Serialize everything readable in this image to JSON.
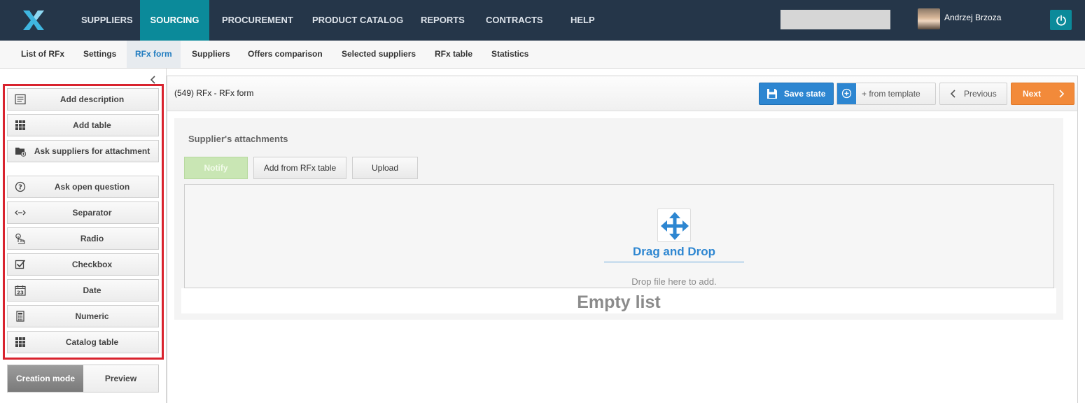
{
  "topnav": {
    "items": [
      "SUPPLIERS",
      "SOURCING",
      "PROCUREMENT",
      "PRODUCT CATALOG",
      "REPORTS",
      "CONTRACTS",
      "HELP"
    ],
    "active": "SOURCING"
  },
  "user": {
    "name": "Andrzej Brzoza"
  },
  "subnav": {
    "items": [
      "List of RFx",
      "Settings",
      "RFx form",
      "Suppliers",
      "Offers comparison",
      "Selected suppliers",
      "RFx table",
      "Statistics"
    ],
    "active": "RFx form"
  },
  "sidebar": {
    "tools": [
      {
        "label": "Add description",
        "icon": "description-icon"
      },
      {
        "label": "Add table",
        "icon": "grid-icon"
      },
      {
        "label": "Ask suppliers for attachment",
        "icon": "folder-plus-icon"
      },
      {
        "label": "Ask open question",
        "icon": "question-circle-icon"
      },
      {
        "label": "Separator",
        "icon": "separator-icon"
      },
      {
        "label": "Radio",
        "icon": "pointer-icon"
      },
      {
        "label": "Checkbox",
        "icon": "checkbox-icon"
      },
      {
        "label": "Date",
        "icon": "calendar-icon"
      },
      {
        "label": "Numeric",
        "icon": "calculator-icon"
      },
      {
        "label": "Catalog table",
        "icon": "grid-icon"
      }
    ],
    "modes": {
      "creation": "Creation mode",
      "preview": "Preview",
      "active": "Creation mode"
    }
  },
  "panel": {
    "title": "(549) RFx - RFx form",
    "save": "Save state",
    "template": "+ from template",
    "previous": "Previous",
    "next": "Next"
  },
  "attachments": {
    "label": "Supplier's attachments",
    "notify": "Notify",
    "add_from": "Add from RFx table",
    "upload": "Upload",
    "drop_title": "Drag and Drop",
    "drop_hint": "Drop file here to add.",
    "empty": "Empty list"
  },
  "colors": {
    "topbar": "#253649",
    "accent": "#0b8a9a",
    "save": "#2d86d1",
    "next": "#f28a3a",
    "highlight": "#d9232e"
  }
}
